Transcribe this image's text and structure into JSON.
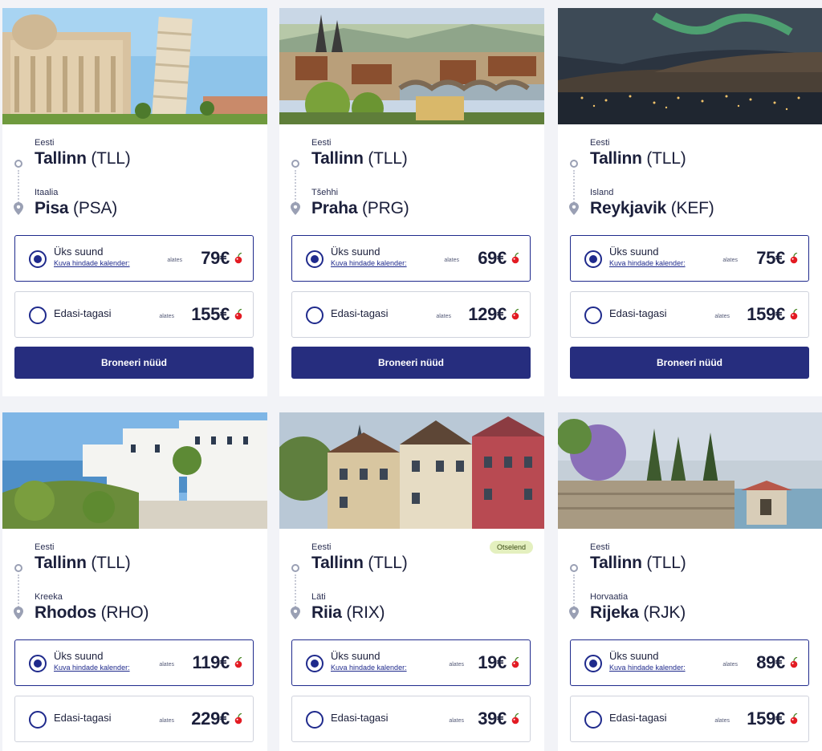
{
  "colors": {
    "primary": "#262d7e",
    "accent": "#e31b23",
    "badge_bg": "#e4f0bf"
  },
  "labels": {
    "one_way": "Üks suund",
    "calendar": "Kuva hindade kalender:",
    "round_trip": "Edasi-tagasi",
    "from": "alates",
    "book": "Broneeri nüüd"
  },
  "cards": [
    {
      "photo": "pisa-photo",
      "from_country": "Eesti",
      "from_city": "Tallinn",
      "from_code": "(TLL)",
      "to_country": "Itaalia",
      "to_city": "Pisa",
      "to_code": "(PSA)",
      "one_way_price": "79€",
      "round_trip_price": "155€",
      "badge": ""
    },
    {
      "photo": "prague-photo",
      "from_country": "Eesti",
      "from_city": "Tallinn",
      "from_code": "(TLL)",
      "to_country": "Tšehhi",
      "to_city": "Praha",
      "to_code": "(PRG)",
      "one_way_price": "69€",
      "round_trip_price": "129€",
      "badge": ""
    },
    {
      "photo": "reykjavik-photo",
      "from_country": "Eesti",
      "from_city": "Tallinn",
      "from_code": "(TLL)",
      "to_country": "Island",
      "to_city": "Reykjavik",
      "to_code": "(KEF)",
      "one_way_price": "75€",
      "round_trip_price": "159€",
      "badge": ""
    },
    {
      "photo": "rhodes-photo",
      "from_country": "Eesti",
      "from_city": "Tallinn",
      "from_code": "(TLL)",
      "to_country": "Kreeka",
      "to_city": "Rhodos",
      "to_code": "(RHO)",
      "one_way_price": "119€",
      "round_trip_price": "229€",
      "badge": ""
    },
    {
      "photo": "riga-photo",
      "from_country": "Eesti",
      "from_city": "Tallinn",
      "from_code": "(TLL)",
      "to_country": "Läti",
      "to_city": "Riia",
      "to_code": "(RIX)",
      "one_way_price": "19€",
      "round_trip_price": "39€",
      "badge": "Otselend"
    },
    {
      "photo": "rijeka-photo",
      "from_country": "Eesti",
      "from_city": "Tallinn",
      "from_code": "(TLL)",
      "to_country": "Horvaatia",
      "to_city": "Rijeka",
      "to_code": "(RJK)",
      "one_way_price": "89€",
      "round_trip_price": "159€",
      "badge": ""
    }
  ]
}
